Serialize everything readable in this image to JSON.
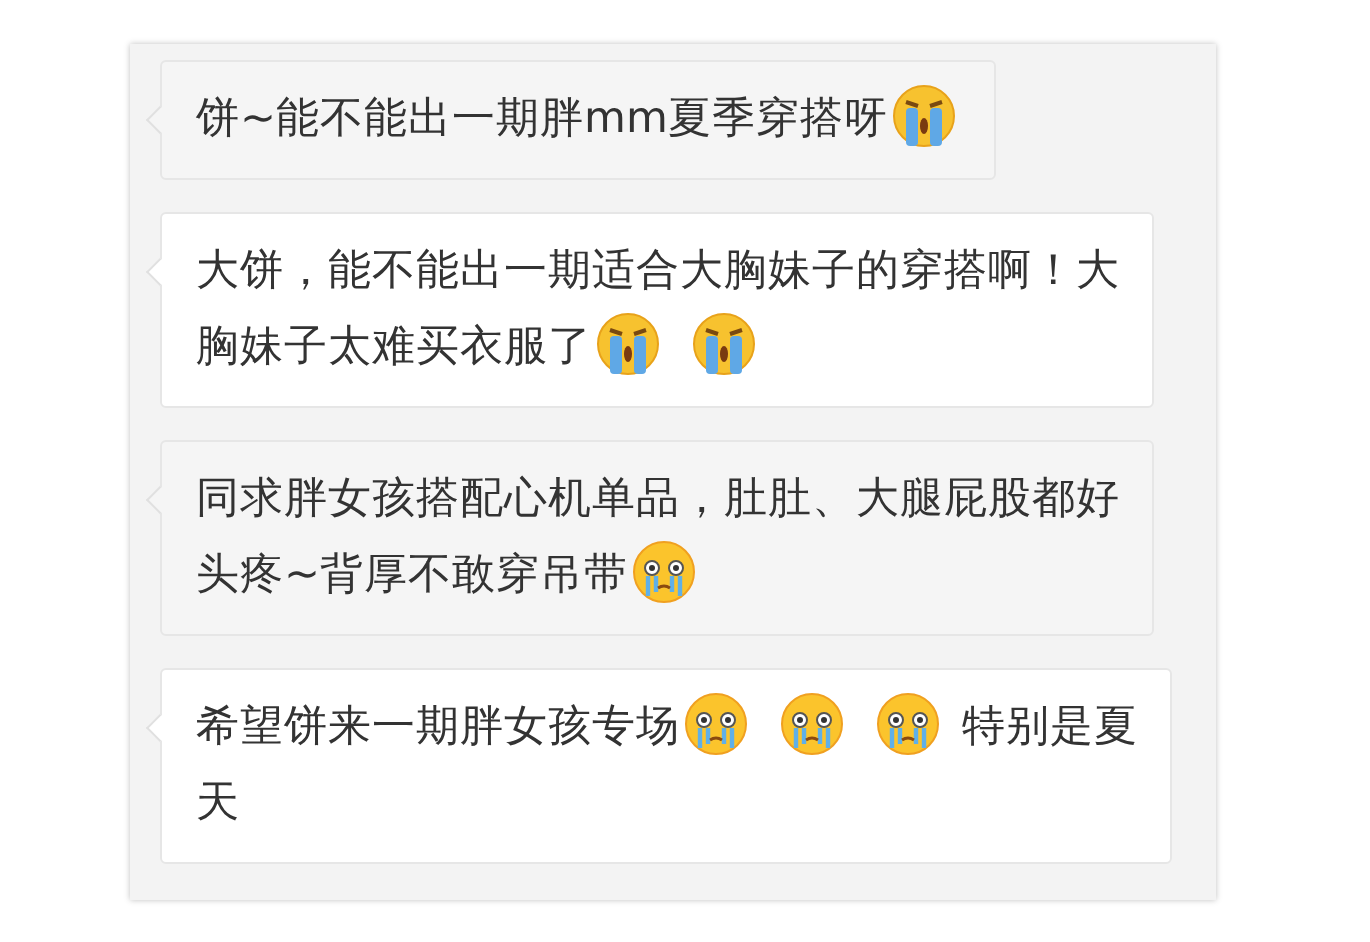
{
  "comments": [
    {
      "lines": [
        [
          {
            "kind": "text",
            "text": "饼~能不能出一期胖mm夏季穿搭呀"
          },
          {
            "kind": "sob"
          }
        ]
      ]
    },
    {
      "lines": [
        [
          {
            "kind": "text",
            "text": "大饼，能不能出一期适合大胸妹子的穿搭啊！大"
          }
        ],
        [
          {
            "kind": "text",
            "text": "胸妹子太难买衣服了"
          },
          {
            "kind": "sob"
          },
          {
            "kind": "sob"
          }
        ]
      ]
    },
    {
      "lines": [
        [
          {
            "kind": "text",
            "text": "同求胖女孩搭配心机单品，肚肚、大腿屁股都好"
          }
        ],
        [
          {
            "kind": "text",
            "text": "头疼~背厚不敢穿吊带"
          },
          {
            "kind": "tears"
          }
        ]
      ]
    },
    {
      "lines": [
        [
          {
            "kind": "text",
            "text": "希望饼来一期胖女孩专场"
          },
          {
            "kind": "tears"
          },
          {
            "kind": "tears"
          },
          {
            "kind": "tears"
          },
          {
            "kind": "text",
            "text": "特别是夏"
          }
        ],
        [
          {
            "kind": "text",
            "text": "天"
          }
        ]
      ]
    }
  ]
}
